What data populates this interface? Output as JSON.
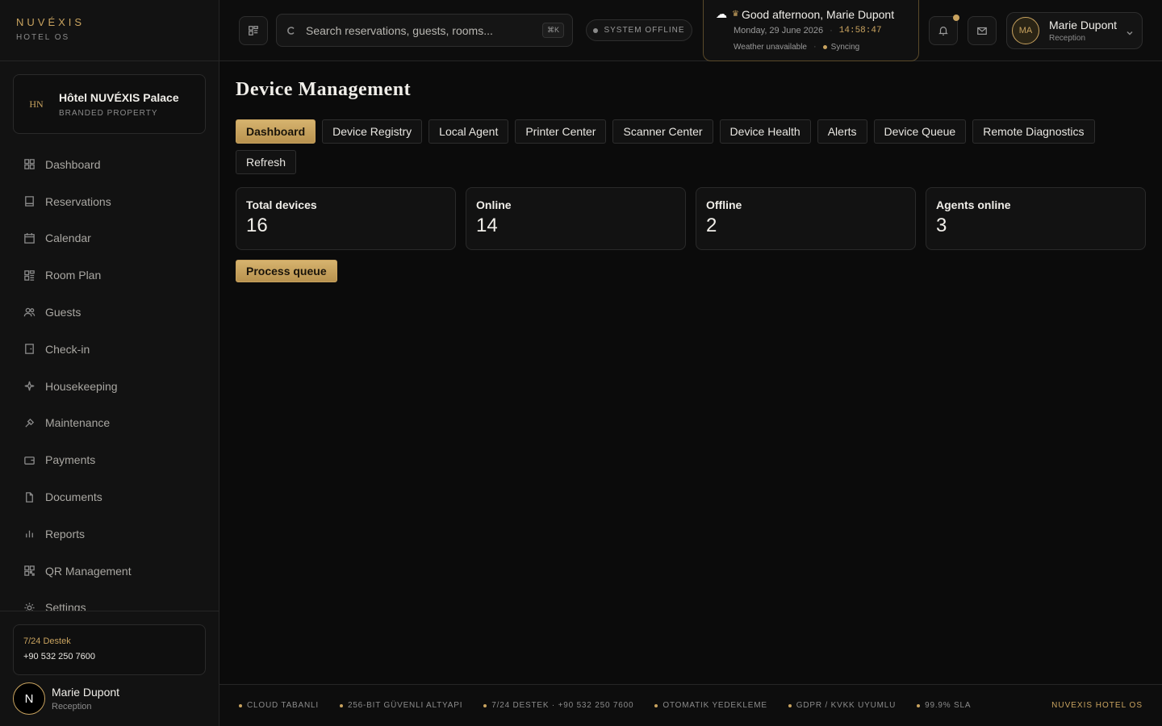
{
  "brand": {
    "name": "NUVÉXIS",
    "sub": "HOTEL OS"
  },
  "property": {
    "badge": "HN",
    "name": "Hôtel NUVÉXIS Palace",
    "type": "BRANDED PROPERTY"
  },
  "sidebar": {
    "items": [
      {
        "label": "Dashboard",
        "icon": "grid-icon"
      },
      {
        "label": "Reservations",
        "icon": "book-icon"
      },
      {
        "label": "Calendar",
        "icon": "calendar-icon"
      },
      {
        "label": "Room Plan",
        "icon": "floorplan-icon"
      },
      {
        "label": "Guests",
        "icon": "users-icon"
      },
      {
        "label": "Check-in",
        "icon": "door-icon"
      },
      {
        "label": "Housekeeping",
        "icon": "sparkle-icon"
      },
      {
        "label": "Maintenance",
        "icon": "wrench-icon"
      },
      {
        "label": "Payments",
        "icon": "wallet-icon"
      },
      {
        "label": "Documents",
        "icon": "document-icon"
      },
      {
        "label": "Reports",
        "icon": "bar-chart-icon"
      },
      {
        "label": "QR Management",
        "icon": "qr-icon"
      },
      {
        "label": "Settings",
        "icon": "gear-icon"
      }
    ]
  },
  "support": {
    "title": "7/24 Destek",
    "phone": "+90 532 250 7600"
  },
  "sidebar_user": {
    "initial": "N",
    "name": "Marie Dupont",
    "role": "Reception"
  },
  "search": {
    "placeholder": "Search reservations, guests, rooms...",
    "shortcut": "⌘K"
  },
  "status": {
    "text": "SYSTEM OFFLINE"
  },
  "greeting": {
    "text": "Good afternoon, Marie Dupont",
    "date": "Monday, 29 June 2026",
    "time": "14:58:47",
    "weather": "Weather unavailable",
    "sync": "Syncing"
  },
  "user": {
    "initials": "MA",
    "name": "Marie Dupont",
    "role": "Reception"
  },
  "page": {
    "title": "Device Management"
  },
  "tabs": [
    {
      "label": "Dashboard",
      "active": true
    },
    {
      "label": "Device Registry"
    },
    {
      "label": "Local Agent"
    },
    {
      "label": "Printer Center"
    },
    {
      "label": "Scanner Center"
    },
    {
      "label": "Device Health"
    },
    {
      "label": "Alerts"
    },
    {
      "label": "Device Queue"
    },
    {
      "label": "Remote Diagnostics"
    },
    {
      "label": "Refresh"
    }
  ],
  "stats": [
    {
      "label": "Total devices",
      "value": "16"
    },
    {
      "label": "Online",
      "value": "14"
    },
    {
      "label": "Offline",
      "value": "2"
    },
    {
      "label": "Agents online",
      "value": "3"
    }
  ],
  "actions": {
    "process_queue": "Process queue"
  },
  "footer": {
    "items": [
      "CLOUD TABANLI",
      "256-BIT GÜVENLI ALTYAPI",
      "7/24 DESTEK · +90 532 250 7600",
      "OTOMATIK YEDEKLEME",
      "GDPR / KVKK UYUMLU",
      "99.9% SLA"
    ],
    "brand": "NUVEXIS HOTEL OS"
  },
  "colors": {
    "accent": "#c9a35f",
    "background": "#0b0b0b",
    "panel": "#121212"
  }
}
